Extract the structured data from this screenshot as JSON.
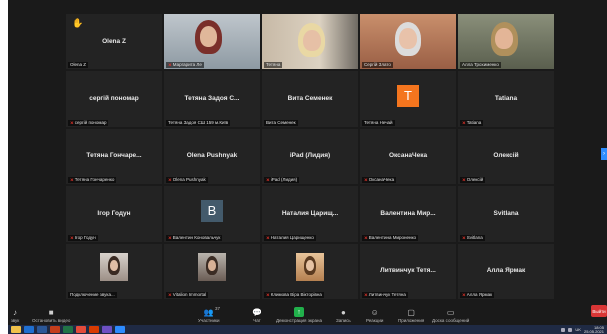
{
  "tiles": [
    {
      "name": "Olena Z",
      "label": "Olena Z",
      "muted": false,
      "hand": true
    },
    {
      "name": "",
      "label": "Маргарита Ле",
      "muted": true
    },
    {
      "name": "",
      "label": "Тетяна",
      "muted": false,
      "active": true
    },
    {
      "name": "",
      "label": "Сергій Злато",
      "muted": false
    },
    {
      "name": "",
      "label": "Алла Трохименко",
      "muted": false
    },
    {
      "name": "сергій пономар",
      "label": "сергій пономар",
      "muted": true
    },
    {
      "name": "Тетяна Задоя С...",
      "label": "Тетяна Задоя СШ 159 м.Київ",
      "muted": false
    },
    {
      "name": "Вита Семенек",
      "label": "Вита Семенек",
      "muted": false
    },
    {
      "name": "",
      "label": "Тетяна Нечай",
      "muted": false,
      "avatar": "T",
      "avatarColor": "#f4751e"
    },
    {
      "name": "Tatiana",
      "label": "Tatiana",
      "muted": true
    },
    {
      "name": "Тетяна Гончаре...",
      "label": "Тетяна Гончаренко",
      "muted": true
    },
    {
      "name": "Olena Pushnyak",
      "label": "Olena Pushnyak",
      "muted": true
    },
    {
      "name": "iPad (Лидия)",
      "label": "iPad (Лидия)",
      "muted": true
    },
    {
      "name": "ОксанаЧека",
      "label": "ОксанаЧека",
      "muted": true
    },
    {
      "name": "Олексій",
      "label": "Олексій",
      "muted": true
    },
    {
      "name": "Ігор Годун",
      "label": "Ігор Годун",
      "muted": true
    },
    {
      "name": "",
      "label": "Валентин Коновальчук",
      "muted": true,
      "avatar": "B",
      "avatarColor": "#435a6b"
    },
    {
      "name": "Наталия Царищ...",
      "label": "Наталия Царищенко",
      "muted": true
    },
    {
      "name": "Валентина Мир...",
      "label": "Валентина Мироненко",
      "muted": true
    },
    {
      "name": "Svitlana",
      "label": "Svitlana",
      "muted": true
    },
    {
      "name": "",
      "label": "Подключение звука...",
      "muted": false
    },
    {
      "name": "",
      "label": "Vitalion Immortal",
      "muted": true
    },
    {
      "name": "",
      "label": "Климова Віра Вікторівна",
      "muted": true
    },
    {
      "name": "Литвинчук Тетя...",
      "label": "Литвинчук Тетяна",
      "muted": true
    },
    {
      "name": "Алла Ярмак",
      "label": "Алла Ярмак",
      "muted": true
    }
  ],
  "toolbar": {
    "join_audio": "звук",
    "stop_video": "Остановить видео",
    "participants": "Участники",
    "participants_count": "37",
    "chat": "Чат",
    "share_screen": "Демонстрация экрана",
    "record": "Запись",
    "reactions": "Реакции",
    "apps": "Приложения",
    "whiteboards": "Доска сообщений",
    "end": "Выйти"
  },
  "tray": {
    "lang": "UK",
    "time": "18:05",
    "date": "25.05.2021"
  },
  "colors": {
    "share": "#21b04b",
    "end": "#d93636",
    "active_border": "#e6dc27",
    "muted": "#e5332a"
  }
}
